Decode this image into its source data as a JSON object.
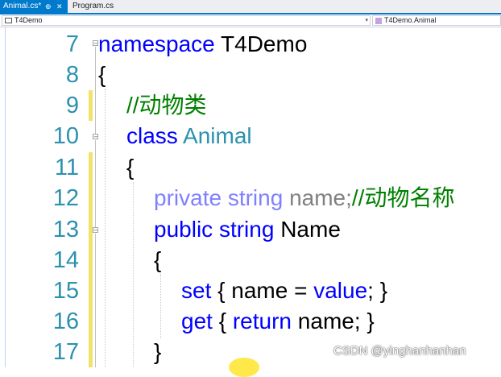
{
  "tabs": [
    {
      "label": "Animal.cs*",
      "pin": "⊕",
      "close": "✕",
      "active": true
    },
    {
      "label": "Program.cs",
      "active": false
    }
  ],
  "navbar": {
    "project": "T4Demo",
    "type": "T4Demo.Animal"
  },
  "editor": {
    "lines": [
      {
        "num": "7"
      },
      {
        "num": "8"
      },
      {
        "num": "9"
      },
      {
        "num": "10"
      },
      {
        "num": "11"
      },
      {
        "num": "12"
      },
      {
        "num": "13"
      },
      {
        "num": "14"
      },
      {
        "num": "15"
      },
      {
        "num": "16"
      },
      {
        "num": "17"
      }
    ],
    "code": {
      "l7_kw": "namespace",
      "l7_name": " T4Demo",
      "l8_text": "{",
      "l9_comment": "//动物类",
      "l10_kw": "class",
      "l10_type": "Animal",
      "l11_text": "{",
      "l12_kw1": "private",
      "l12_kw2": "string",
      "l12_name": "name;",
      "l12_comment": "//动物名称",
      "l13_kw1": "public",
      "l13_kw2": "string",
      "l13_name": "Name",
      "l14_text": "{",
      "l15_kw1": "set",
      "l15_mid": " { name = ",
      "l15_kw2": "value",
      "l15_end": "; }",
      "l16_kw1": "get",
      "l16_mid": " { ",
      "l16_kw2": "return",
      "l16_end": " name; }",
      "l17_text": "}"
    }
  },
  "watermark": "CSDN @yinghanhanhan"
}
